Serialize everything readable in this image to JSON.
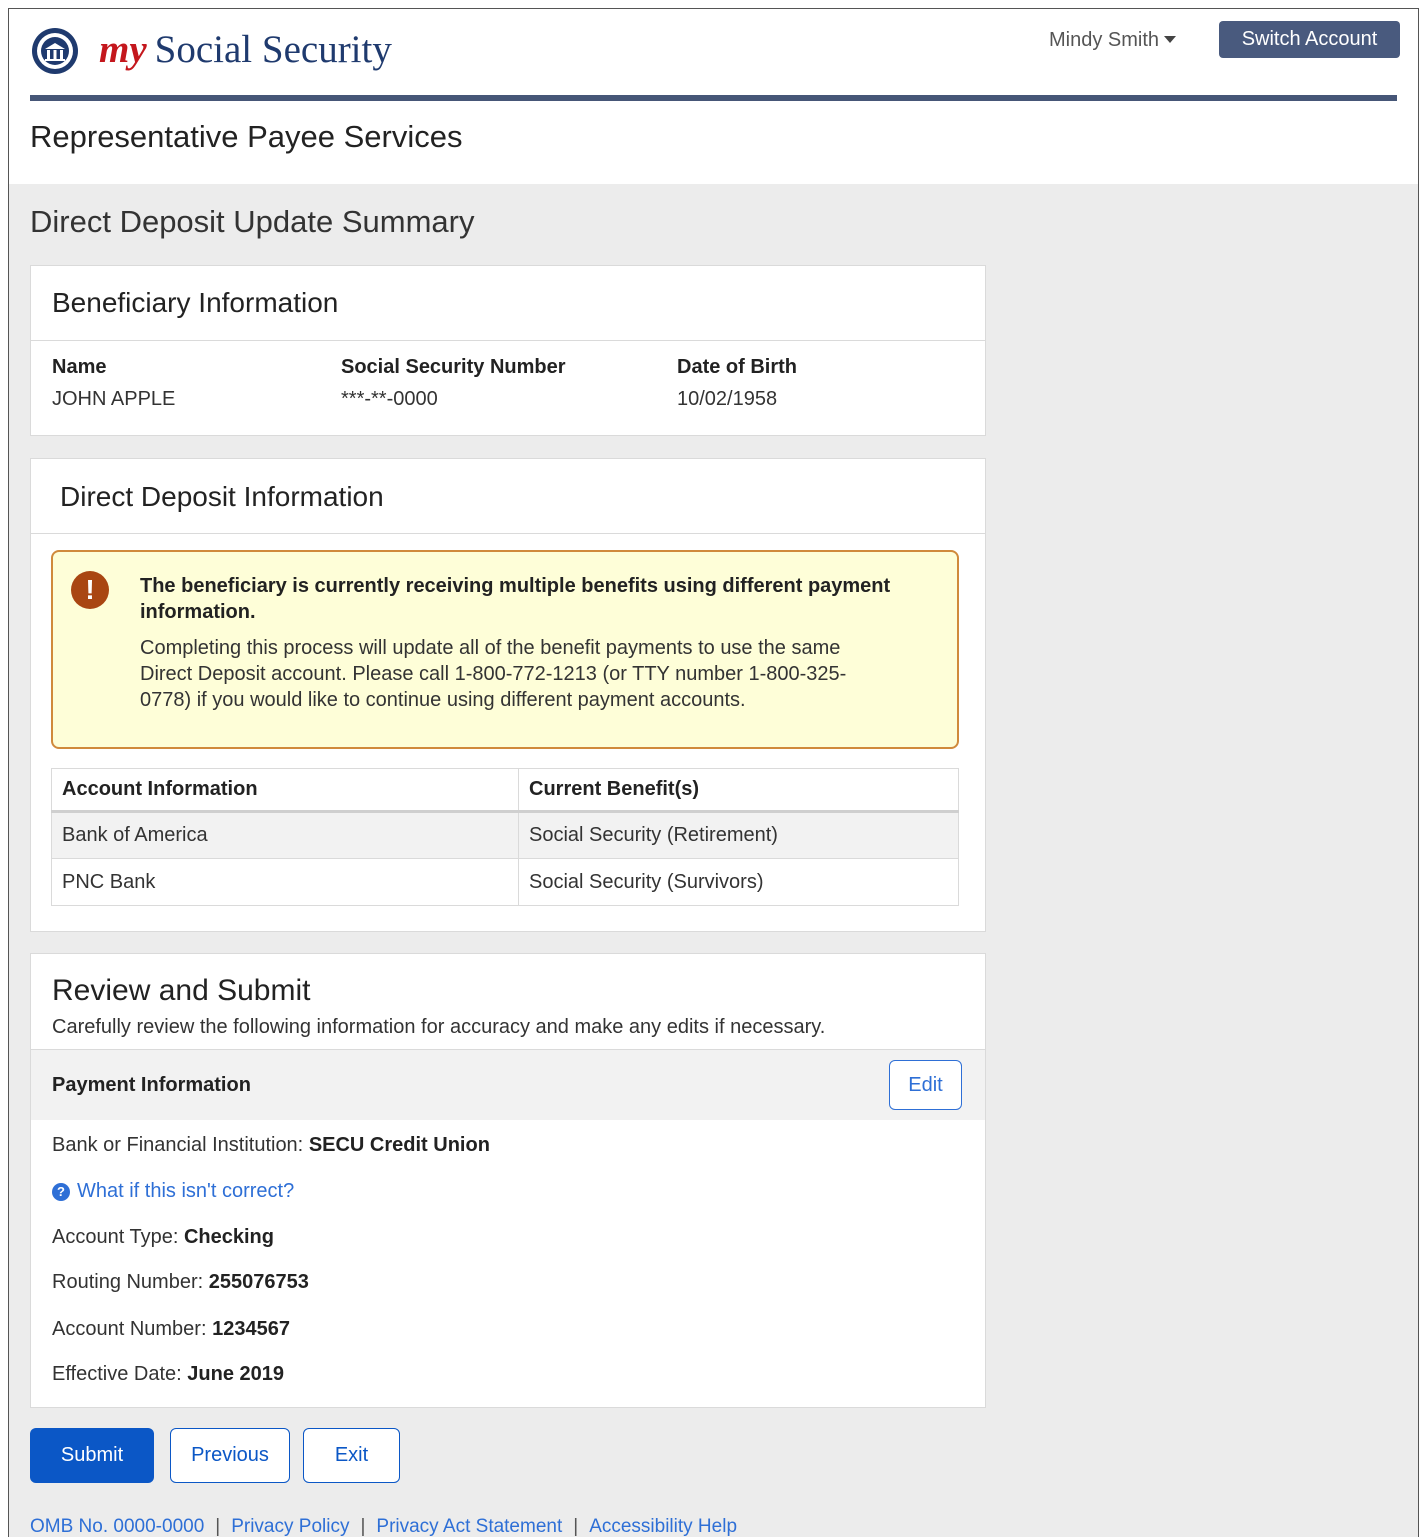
{
  "header": {
    "brand_my": "my",
    "brand_rest": "Social Security",
    "user_name": "Mindy Smith",
    "switch_account": "Switch Account",
    "logo_icon": "ssa-seal-icon"
  },
  "service_title": "Representative Payee Services",
  "page_title": "Direct Deposit Update Summary",
  "beneficiary": {
    "title": "Beneficiary Information",
    "name_label": "Name",
    "name_value": "JOHN APPLE",
    "ssn_label": "Social Security Number",
    "ssn_value": "***-**-0000",
    "dob_label": "Date of Birth",
    "dob_value": "10/02/1958"
  },
  "direct_deposit": {
    "title": "Direct Deposit Information",
    "alert": {
      "icon": "exclamation-icon",
      "heading": "The beneficiary is currently receiving multiple benefits using different payment information.",
      "body": "Completing this process will update all of the benefit payments to use the same Direct Deposit account.  Please call 1-800-772-1213 (or TTY number 1-800-325-0778) if you would like to continue using different payment accounts."
    },
    "table": {
      "headers": [
        "Account Information",
        "Current Benefit(s)"
      ],
      "rows": [
        [
          "Bank of America",
          "Social Security (Retirement)"
        ],
        [
          "PNC Bank",
          "Social Security (Survivors)"
        ]
      ]
    }
  },
  "review": {
    "title": "Review and Submit",
    "description": "Carefully review the following information for accuracy and make any edits if necessary.",
    "payment_heading": "Payment Information",
    "edit_label": "Edit",
    "bank_label": "Bank or Financial Institution:",
    "bank_value": "SECU Credit Union",
    "help_link": "What if this isn't correct?",
    "account_type_label": "Account Type:",
    "account_type_value": "Checking",
    "routing_label": "Routing Number:",
    "routing_value": "255076753",
    "account_number_label": "Account Number:",
    "account_number_value": "1234567",
    "effective_label": "Effective Date:",
    "effective_value": "June 2019"
  },
  "actions": {
    "submit": "Submit",
    "previous": "Previous",
    "exit": "Exit"
  },
  "footer": {
    "omb": "OMB No. 0000-0000",
    "privacy_policy": "Privacy Policy",
    "privacy_act": "Privacy Act Statement",
    "accessibility": "Accessibility Help",
    "separator": "|"
  },
  "colors": {
    "brand_navy": "#1f3a6e",
    "brand_red": "#c4171d",
    "header_rule": "#465677",
    "primary_blue": "#0b57c6",
    "alert_bg": "#fefed8",
    "alert_border": "#d08a3c"
  }
}
